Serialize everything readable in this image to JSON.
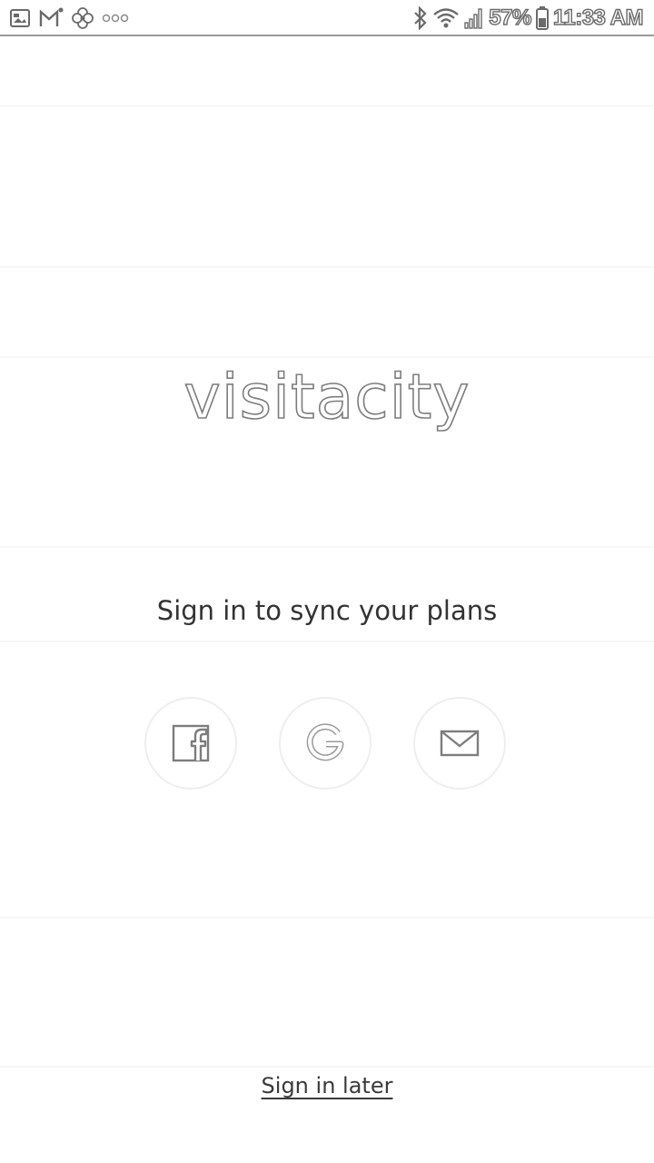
{
  "status_bar": {
    "left_icons": [
      "gallery-icon",
      "gmail-icon",
      "pinwheel-icon",
      "more-notifications-icon"
    ],
    "right_icons": [
      "bluetooth-icon",
      "wifi-icon",
      "signal-icon",
      "battery-icon"
    ],
    "battery_percent": "57%",
    "time": "11:33 AM"
  },
  "app": {
    "logo": "visitacity",
    "tagline": "Sign in to sync your plans",
    "sign_in_options": [
      {
        "name": "facebook",
        "icon": "facebook-icon"
      },
      {
        "name": "google",
        "icon": "google-icon"
      },
      {
        "name": "email",
        "icon": "mail-icon"
      }
    ],
    "sign_in_later": "Sign in later"
  },
  "colors": {
    "background": "#ffffff",
    "text": "#333333",
    "icon_outline": "#7d7d7d",
    "status_bar_border": "#9a9a9a"
  }
}
